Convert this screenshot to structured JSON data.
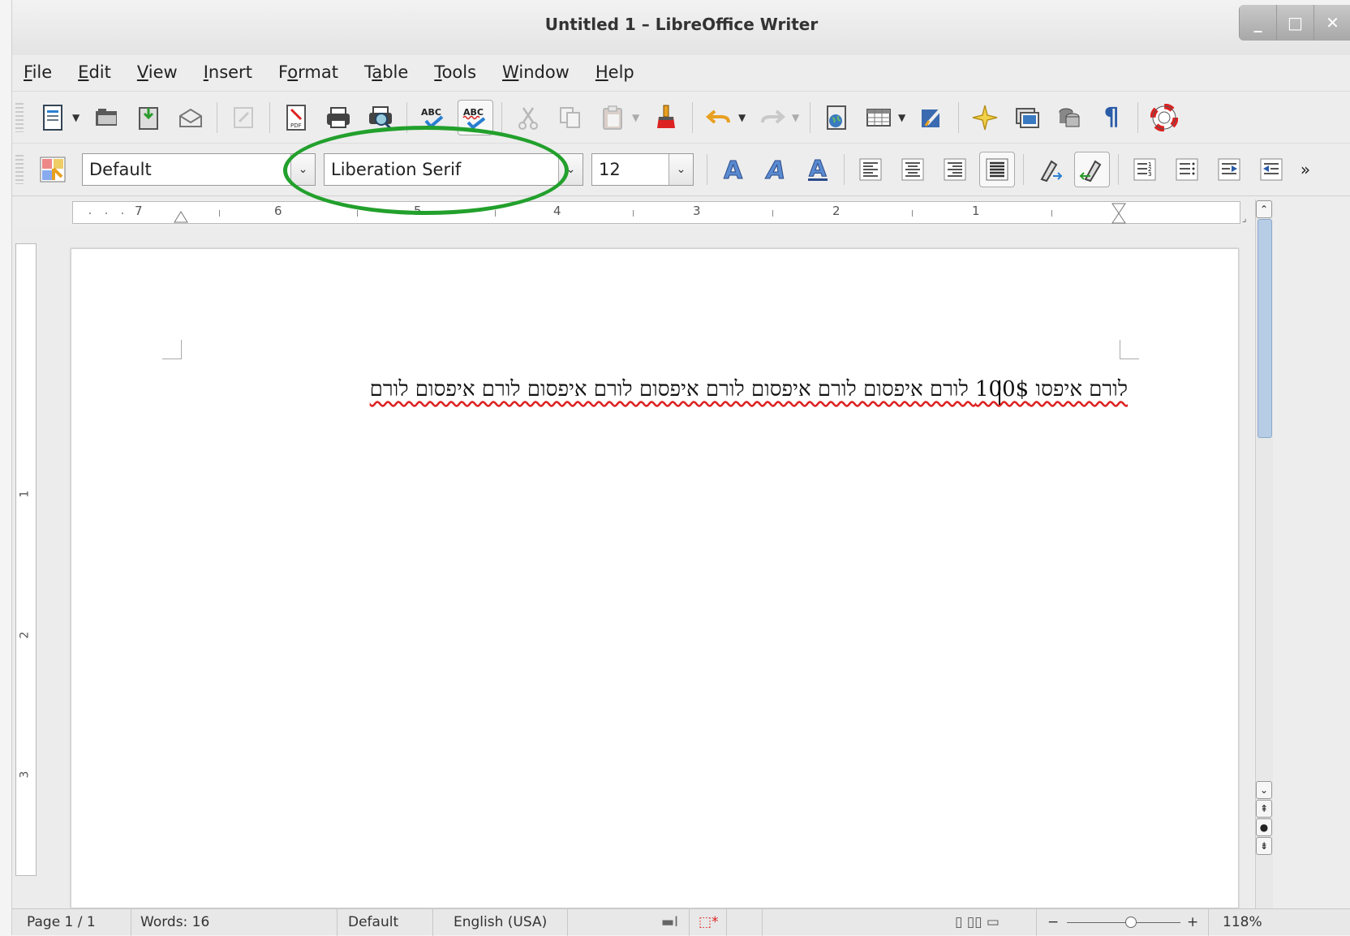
{
  "window": {
    "title": "Untitled 1 – LibreOffice Writer",
    "minimize": "_",
    "maximize": "□",
    "close": "✕"
  },
  "menu": [
    {
      "pre": "",
      "key": "F",
      "post": "ile"
    },
    {
      "pre": "",
      "key": "E",
      "post": "dit"
    },
    {
      "pre": "",
      "key": "V",
      "post": "iew"
    },
    {
      "pre": "",
      "key": "I",
      "post": "nsert"
    },
    {
      "pre": "F",
      "key": "o",
      "post": "rmat"
    },
    {
      "pre": "T",
      "key": "a",
      "post": "ble"
    },
    {
      "pre": "",
      "key": "T",
      "post": "ools"
    },
    {
      "pre": "",
      "key": "W",
      "post": "indow"
    },
    {
      "pre": "",
      "key": "H",
      "post": "elp"
    }
  ],
  "formatting": {
    "paragraph_style": "Default",
    "font_name": "Liberation Serif",
    "font_size": "12",
    "more": "»"
  },
  "ruler": {
    "labels": [
      "7",
      "6",
      "5",
      "4",
      "3",
      "2",
      "1"
    ]
  },
  "vruler": {
    "labels": [
      "1",
      "2",
      "3"
    ]
  },
  "document": {
    "text": "לורם איפסו 100$ לורם איפסום לורם איפסום לורם איפסום לורם איפסום לורם איפסום לורם"
  },
  "status": {
    "page": "Page 1 / 1",
    "words": "Words: 16",
    "style": "Default",
    "language": "English (USA)",
    "zoom_minus": "−",
    "zoom_plus": "+",
    "zoom": "118%"
  },
  "colors": {
    "highlight_ellipse": "#22a02c",
    "spell_underline": "#dd2222"
  }
}
